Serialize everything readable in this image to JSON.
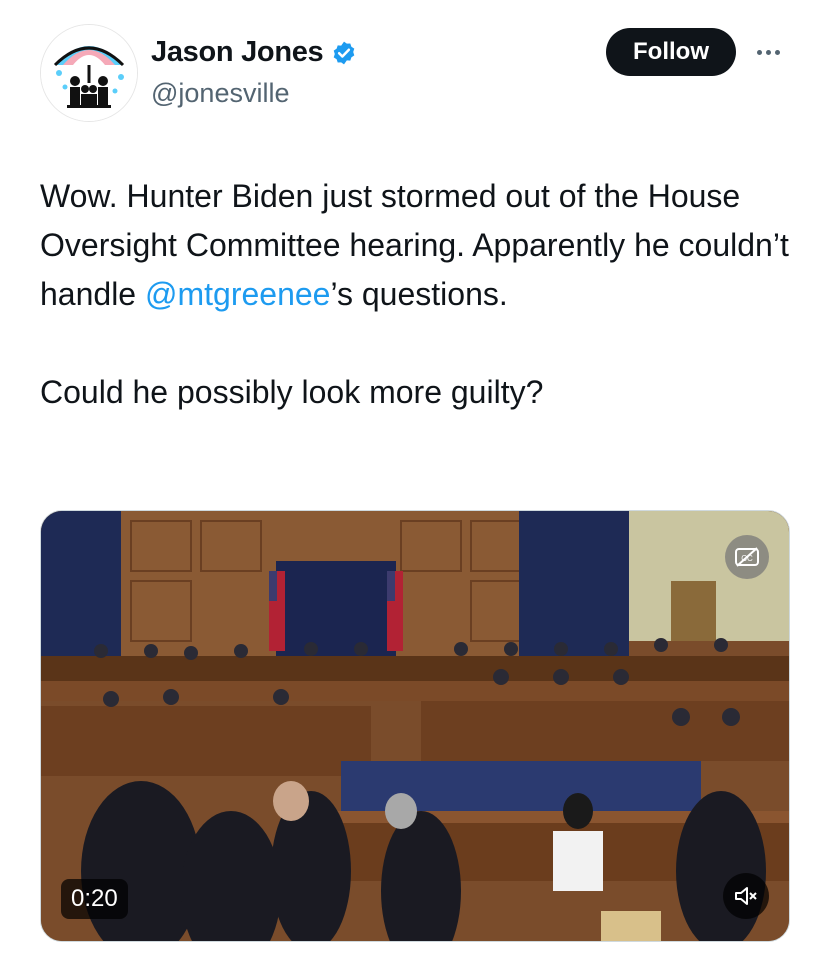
{
  "author": {
    "display_name": "Jason Jones",
    "handle": "@jonesville",
    "verified": true,
    "avatar_icon": "umbrella-family-icon"
  },
  "actions": {
    "follow_label": "Follow",
    "more_icon": "more-horizontal-icon"
  },
  "tweet": {
    "text_part1": "Wow. Hunter Biden just stormed out of the House Oversight Committee hearing. Apparently he couldn’t handle ",
    "mention": "@mtgreenee",
    "text_part2": "’s questions.",
    "text_para2": "Could he possibly look more guilty?"
  },
  "media": {
    "type": "video",
    "duration": "0:20",
    "captions_icon": "closed-captions-off-icon",
    "mute_icon": "muted-speaker-icon"
  },
  "colors": {
    "text": "#0f1419",
    "secondary": "#536471",
    "link": "#1d9bf0",
    "verified": "#1d9bf0",
    "follow_bg": "#0f1419"
  }
}
